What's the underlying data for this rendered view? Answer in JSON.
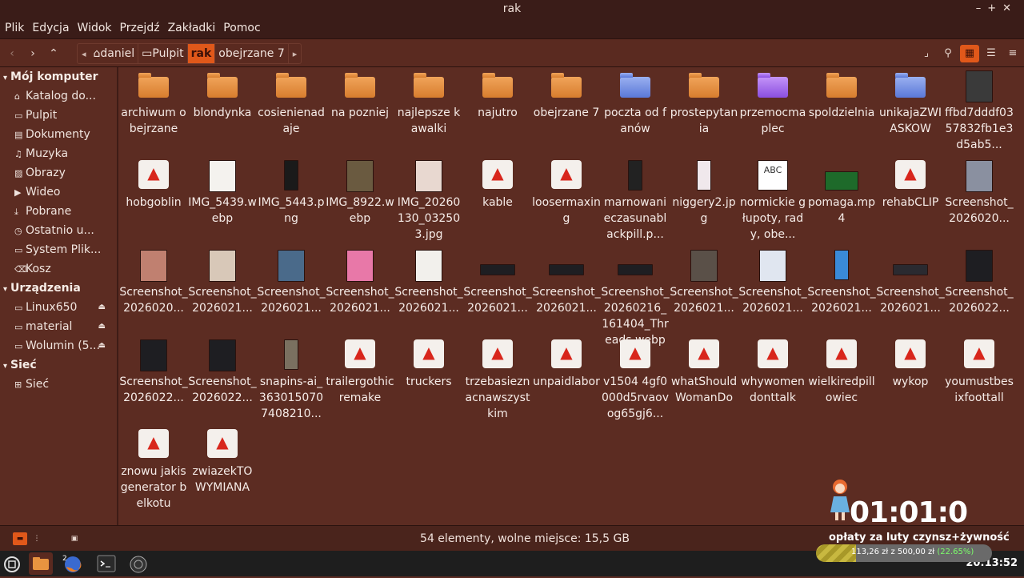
{
  "window": {
    "title": "rak"
  },
  "menu": [
    "Plik",
    "Edycja",
    "Widok",
    "Przejdź",
    "Zakładki",
    "Pomoc"
  ],
  "breadcrumb": [
    "daniel",
    "Pulpit",
    "rak",
    "obejrzane 7"
  ],
  "sidebar": {
    "sections": [
      {
        "title": "Mój komputer",
        "items": [
          {
            "label": "Katalog do...",
            "icon": "home-icon"
          },
          {
            "label": "Pulpit",
            "icon": "folder-icon"
          },
          {
            "label": "Dokumenty",
            "icon": "document-icon"
          },
          {
            "label": "Muzyka",
            "icon": "music-icon"
          },
          {
            "label": "Obrazy",
            "icon": "image-icon"
          },
          {
            "label": "Wideo",
            "icon": "video-icon"
          },
          {
            "label": "Pobrane",
            "icon": "download-icon"
          },
          {
            "label": "Ostatnio u...",
            "icon": "recent-icon"
          },
          {
            "label": "System Plik...",
            "icon": "drive-icon"
          },
          {
            "label": "Kosz",
            "icon": "trash-icon"
          }
        ]
      },
      {
        "title": "Urządzenia",
        "items": [
          {
            "label": "Linux650",
            "icon": "drive-icon",
            "eject": true
          },
          {
            "label": "material",
            "icon": "drive-icon",
            "eject": true
          },
          {
            "label": "Wolumin (5...",
            "icon": "drive-icon",
            "eject": true
          }
        ]
      },
      {
        "title": "Sieć",
        "items": [
          {
            "label": "Sieć",
            "icon": "network-icon"
          }
        ]
      }
    ]
  },
  "files": [
    {
      "name": "archiwum obejrzane",
      "kind": "folder",
      "color": "orange"
    },
    {
      "name": "blondynka",
      "kind": "folder",
      "color": "orange"
    },
    {
      "name": "cosienienadaje",
      "kind": "folder",
      "color": "orange"
    },
    {
      "name": "na pozniej",
      "kind": "folder",
      "color": "orange"
    },
    {
      "name": "najlepsze kawalki",
      "kind": "folder",
      "color": "orange"
    },
    {
      "name": "najutro",
      "kind": "folder",
      "color": "orange"
    },
    {
      "name": "obejrzane 7",
      "kind": "folder",
      "color": "orange"
    },
    {
      "name": "poczta od fanów",
      "kind": "folder",
      "color": "blue"
    },
    {
      "name": "prostepytania",
      "kind": "folder",
      "color": "orange"
    },
    {
      "name": "przemocmaplec",
      "kind": "folder",
      "color": "purple"
    },
    {
      "name": "spoldzielnia",
      "kind": "folder",
      "color": "orange"
    },
    {
      "name": "unikajaZWIASKOW",
      "kind": "folder",
      "color": "blue"
    },
    {
      "name": "ffbd7dddf0357832fb1e3d5ab5...",
      "kind": "photo",
      "tone": "#3a3a3a"
    },
    {
      "name": "hobgoblin",
      "kind": "rocket"
    },
    {
      "name": "IMG_5439.webp",
      "kind": "doc",
      "tone": "#f4f2ee"
    },
    {
      "name": "IMG_5443.png",
      "kind": "phone",
      "tone": "#1a1a1a"
    },
    {
      "name": "IMG_8922.webp",
      "kind": "photo",
      "tone": "#6a5a40"
    },
    {
      "name": "IMG_20260130_032503.jpg",
      "kind": "doc",
      "tone": "#e8d8d0"
    },
    {
      "name": "kable",
      "kind": "rocket"
    },
    {
      "name": "loosermaxing",
      "kind": "rocket"
    },
    {
      "name": "marnowanieczasunablackpill.p...",
      "kind": "phone",
      "tone": "#222222"
    },
    {
      "name": "niggery2.jpg",
      "kind": "phone",
      "tone": "#f0e8ec"
    },
    {
      "name": "normickie głupoty, rady, obe...",
      "kind": "abc",
      "tone": "#ffffff"
    },
    {
      "name": "pomaga.mp4",
      "kind": "video",
      "tone": "#1e6a2a"
    },
    {
      "name": "rehabCLIP",
      "kind": "rocket"
    },
    {
      "name": "Screenshot_2026020...",
      "kind": "photo",
      "tone": "#8a90a0"
    },
    {
      "name": "Screenshot_2026020...",
      "kind": "photo",
      "tone": "#c08070"
    },
    {
      "name": "Screenshot_2026021...",
      "kind": "doc",
      "tone": "#d8c8b8"
    },
    {
      "name": "Screenshot_2026021...",
      "kind": "photo",
      "tone": "#4a6a8a"
    },
    {
      "name": "Screenshot_2026021...",
      "kind": "photo",
      "tone": "#e878a8"
    },
    {
      "name": "Screenshot_2026021...",
      "kind": "doc",
      "tone": "#f2f0ec"
    },
    {
      "name": "Screenshot_2026021...",
      "kind": "wide",
      "tone": "#1e1e22"
    },
    {
      "name": "Screenshot_2026021...",
      "kind": "wide",
      "tone": "#1e1e22"
    },
    {
      "name": "Screenshot_20260216_161404_Threads.webp",
      "kind": "wide",
      "tone": "#1e1e22"
    },
    {
      "name": "Screenshot_2026021...",
      "kind": "photo",
      "tone": "#5a5048"
    },
    {
      "name": "Screenshot_2026021...",
      "kind": "doc",
      "tone": "#e0e6f0"
    },
    {
      "name": "Screenshot_2026021...",
      "kind": "phone",
      "tone": "#3a8ad8"
    },
    {
      "name": "Screenshot_2026021...",
      "kind": "wide",
      "tone": "#2a2a30"
    },
    {
      "name": "Screenshot_2026022...",
      "kind": "doc",
      "tone": "#1e1e22"
    },
    {
      "name": "Screenshot_2026022...",
      "kind": "photo",
      "tone": "#1e1e22"
    },
    {
      "name": "Screenshot_2026022...",
      "kind": "photo",
      "tone": "#1e1e22"
    },
    {
      "name": "snapins-ai_3630150707408210...",
      "kind": "phone",
      "tone": "#7a7060"
    },
    {
      "name": "trailergothicremake",
      "kind": "rocket"
    },
    {
      "name": "truckers",
      "kind": "rocket"
    },
    {
      "name": "trzebasieznacnawszystkim",
      "kind": "rocket"
    },
    {
      "name": "unpaidlabor",
      "kind": "rocket"
    },
    {
      "name": "v1504 4gf0000d5rvaovog65gj6...",
      "kind": "rocket"
    },
    {
      "name": "whatShouldWomanDo",
      "kind": "rocket"
    },
    {
      "name": "whywomendonttalk",
      "kind": "rocket"
    },
    {
      "name": "wielkiredpillowiec",
      "kind": "rocket"
    },
    {
      "name": "wykop",
      "kind": "rocket"
    },
    {
      "name": "youmustbesixfoottall",
      "kind": "rocket"
    },
    {
      "name": "znowu jakis generator belkotu",
      "kind": "rocket"
    },
    {
      "name": "zwiazekTOWYMIANA",
      "kind": "rocket"
    }
  ],
  "statusbar": {
    "text": "54 elementy, wolne miejsce: 15,5 GB"
  },
  "overlay": {
    "timer": "01:01:0",
    "goal_label": "opłaty za luty czynsz+żywność",
    "goal_amount": "113,26 zł z 500,00 zł",
    "goal_percent": "(22.65%)",
    "goal_fraction": 0.2265
  },
  "taskbar": {
    "clock": "20:13:52",
    "badge": "2"
  }
}
